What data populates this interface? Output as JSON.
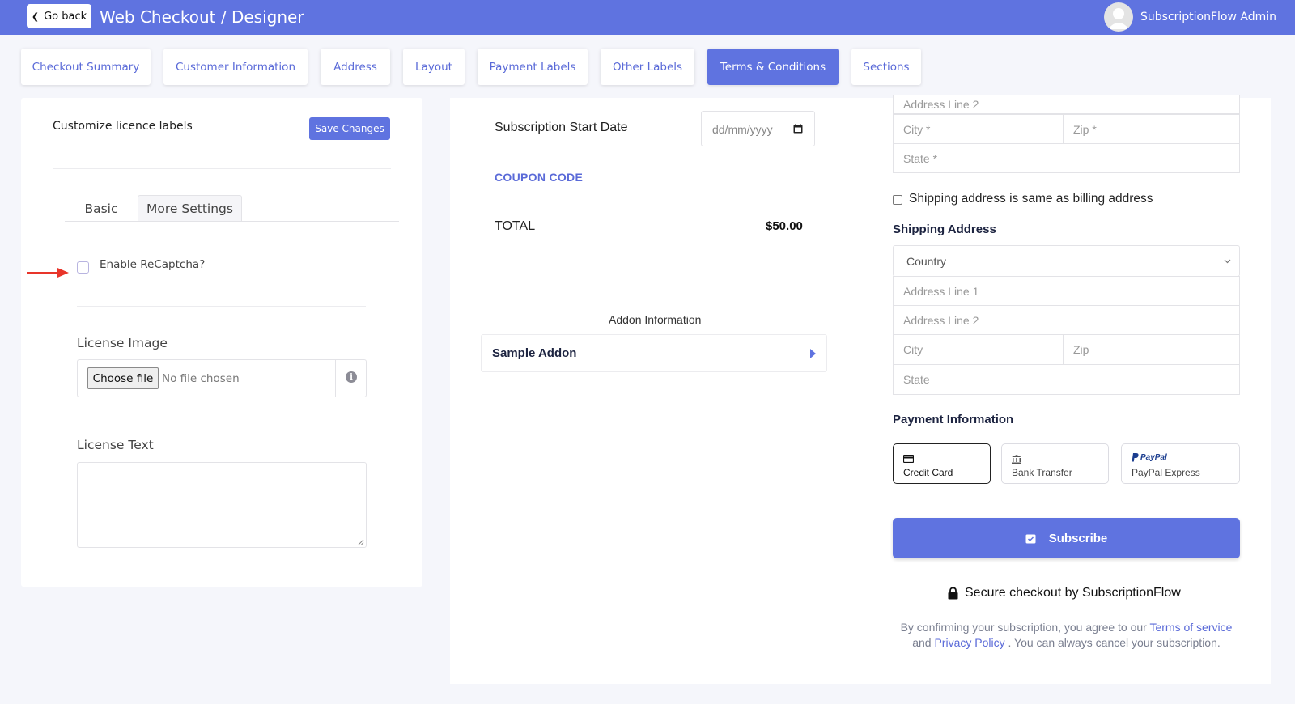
{
  "header": {
    "back_label": "Go back",
    "title": "Web Checkout / Designer",
    "user_name": "SubscriptionFlow Admin"
  },
  "tabs": [
    {
      "label": "Checkout Summary"
    },
    {
      "label": "Customer Information"
    },
    {
      "label": "Address"
    },
    {
      "label": "Layout"
    },
    {
      "label": "Payment Labels"
    },
    {
      "label": "Other Labels"
    },
    {
      "label": "Terms & Conditions",
      "active": true
    },
    {
      "label": "Sections"
    }
  ],
  "licence_panel": {
    "heading": "Customize licence labels",
    "save_label": "Save Changes",
    "subtabs": [
      {
        "label": "Basic"
      },
      {
        "label": "More Settings",
        "active": true
      }
    ],
    "recaptcha_label": "Enable ReCaptcha?",
    "recaptcha_checked": false,
    "license_image_label": "License Image",
    "file_button_label": "Choose file",
    "file_status": "No file chosen",
    "license_text_label": "License Text",
    "license_text_value": ""
  },
  "annotation": {
    "arrow_color": "#e8352a"
  },
  "checkout_preview": {
    "start_date_label": "Subscription Start Date",
    "start_date_placeholder": "dd/mm/yyyy",
    "coupon_label": "COUPON CODE",
    "total_label": "TOTAL",
    "total_value": "$50.00",
    "addon_info_label": "Addon Information",
    "addon_name": "Sample Addon"
  },
  "address_preview": {
    "billing": {
      "address_line_2": "Address Line 2",
      "city": "City *",
      "zip": "Zip *",
      "state": "State *"
    },
    "same_as_billing_label": "Shipping address is same as billing address",
    "shipping_title": "Shipping Address",
    "shipping": {
      "country": "Country",
      "address_line_1": "Address Line 1",
      "address_line_2": "Address Line 2",
      "city": "City",
      "zip": "Zip",
      "state": "State"
    },
    "payment_title": "Payment Information",
    "payment_methods": [
      {
        "label": "Credit Card",
        "icon": "credit-card-icon",
        "active": true
      },
      {
        "label": "Bank Transfer",
        "icon": "bank-icon"
      },
      {
        "label": "PayPal Express",
        "icon": "paypal-icon",
        "logo_text": "PayPal"
      }
    ],
    "subscribe_label": "Subscribe",
    "secure_text": "Secure checkout by SubscriptionFlow",
    "legal": {
      "prefix": "By confirming your subscription, you agree to our",
      "terms_link": "Terms of service",
      "middle": "and",
      "privacy_link": "Privacy Policy",
      "suffix": ". You can always cancel your subscription."
    }
  },
  "colors": {
    "accent": "#5f73e0",
    "link": "#5a6ad8",
    "page_bg": "#f5f6fb"
  }
}
